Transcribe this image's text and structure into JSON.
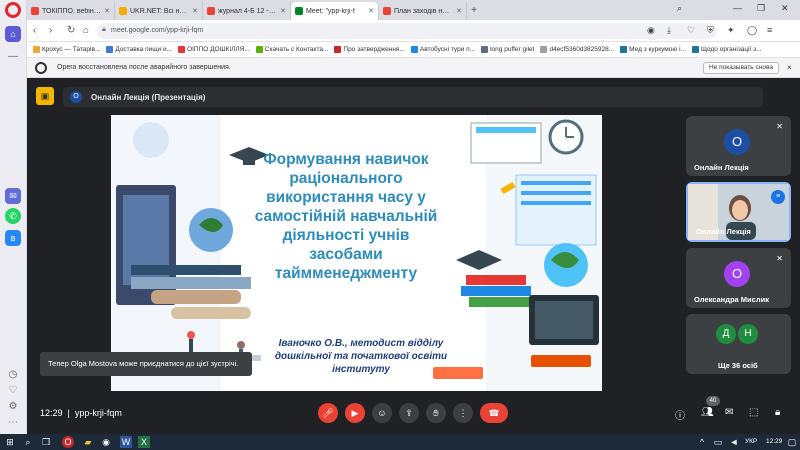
{
  "browser": {
    "tabs": [
      {
        "label": "ТОКІППО, вебінар для ПЕ",
        "color": "#ea4335"
      },
      {
        "label": "UKR.NET: Всі новини Укр",
        "color": "#f9ab00"
      },
      {
        "label": "журнал 4-Б 12 - s.golh@",
        "color": "#ea4335"
      },
      {
        "label": "Мeet: \"ypp-krji-f",
        "color": "#00832d",
        "active": true
      },
      {
        "label": "План заходів на 2024р.",
        "color": "#ea4335"
      }
    ],
    "new_tab": "+",
    "url": "meet.google.com/ypp-krji-fqm",
    "bookmarks": [
      {
        "label": "Крохус — Татарів...",
        "color": "#f2a33a"
      },
      {
        "label": "Доставка пищи и...",
        "color": "#3b7bd6"
      },
      {
        "label": "ОІППО ДОШКІЛЛЯ...",
        "color": "#e53935"
      },
      {
        "label": "Скачать с Контакта...",
        "color": "#59b300"
      },
      {
        "label": "Про затвердження...",
        "color": "#c62828"
      },
      {
        "label": "Автобусні тури п...",
        "color": "#1e88e5"
      },
      {
        "label": "long puffer gilet",
        "color": "#5d6d7e"
      },
      {
        "label": "d4ecf5360d3825928...",
        "color": "#9e9e9e"
      },
      {
        "label": "Мед з куркумою і...",
        "color": "#21759b"
      },
      {
        "label": "Щодо організації з...",
        "color": "#21759b"
      }
    ]
  },
  "infobar": {
    "message": "Opera восстановлена после аварийного завершения.",
    "button": "Не показывать снова",
    "close": "×"
  },
  "meet": {
    "presenter_initial": "О",
    "presenter_name": "Онлайн Лекція (Презентація)",
    "slide": {
      "title": "Формування навичок раціонального використання часу у самостійній навчальній діяльності учнів засобами таймменеджменту",
      "author": "Іваночко О.В., методист відділу дошкільної та початкової освіти інституту"
    },
    "participants": [
      {
        "initial": "О",
        "name": "Онлайн Лекція",
        "color": "#1a4fa3"
      },
      {
        "initial": "",
        "name": "Онлайн Лекція",
        "color": "#8ab4f8"
      },
      {
        "initial": "О",
        "name": "Олександра Мислик",
        "color": "#a142f4"
      },
      {
        "initials": [
          "Д",
          "Н"
        ],
        "name": "Ще 36 осіб",
        "colors": [
          "#1e8e3e",
          "#1e8e3e"
        ]
      }
    ],
    "toast": "Тепер Olga Mostova може приєднатися до цієї зустрічі.",
    "time": "12:29",
    "meeting_code": "ypp-krji-fqm",
    "participants_count": "40"
  },
  "taskbar": {
    "lang": "УКР",
    "clock": "12:29"
  }
}
